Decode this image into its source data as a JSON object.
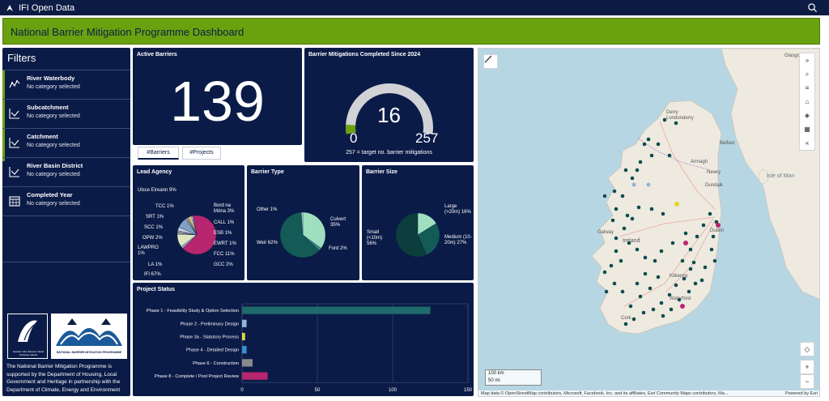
{
  "app": {
    "title": "IFI Open Data"
  },
  "dashboard": {
    "title": "National Barrier Mitigation Programme Dashboard"
  },
  "filters": {
    "title": "Filters",
    "items": [
      {
        "name": "River Waterbody",
        "value": "No category selected",
        "icon": "river-icon"
      },
      {
        "name": "Subcatchment",
        "value": "No category selected",
        "icon": "chart-line-icon"
      },
      {
        "name": "Catchment",
        "value": "No category selected",
        "icon": "chart-line-icon"
      },
      {
        "name": "River Basin District",
        "value": "No category selected",
        "icon": "chart-line-icon"
      },
      {
        "name": "Completed Year",
        "value": "No category selected",
        "icon": "calendar-icon"
      }
    ],
    "logo_ifi_caption": "Iascach Intíre Éireann Inland Fisheries Ireland",
    "logo_nbmp_caption": "NATIONAL BARRIER MITIGATION PROGRAMME",
    "about": "The National Barrier Mitigation Programme is supported by the Department of Housing, Local Government and Heritage in partnership with the Department of Climate, Energy and Environment"
  },
  "active_barriers": {
    "title": "Active Barriers",
    "value": "139"
  },
  "tabs": [
    {
      "label": "#Barriers",
      "selected": true
    },
    {
      "label": "#Projects",
      "selected": false
    }
  ],
  "mitigations": {
    "title": "Barrier Mitigations Completed Since 2024",
    "value": "16",
    "min": "0",
    "max": "257",
    "note": "257 = target no. barrier mitigations",
    "track_color": "#d0d2d6",
    "fill_color": "#6aa10f"
  },
  "lead_agency": {
    "title": "Lead Agency",
    "chart_data": {
      "type": "pie",
      "slices": [
        {
          "label": "IFI 67%",
          "value": 67,
          "color": "#b8256f"
        },
        {
          "label": "GCC 2%",
          "value": 2,
          "color": "#9ab0c8"
        },
        {
          "label": "FCC 11%",
          "value": 11,
          "color": "#dfe7bf"
        },
        {
          "label": "EWRT 1%",
          "value": 1,
          "color": "#8fb0a9"
        },
        {
          "label": "ESB 1%",
          "value": 1,
          "color": "#d9c7a7"
        },
        {
          "label": "CALL 1%",
          "value": 1,
          "color": "#b5b5b5"
        },
        {
          "label": "Bord na Móna 3%",
          "value": 3,
          "color": "#c8d3e0"
        },
        {
          "label": "Ulsce Eireann 9%",
          "value": 9,
          "color": "#7fa0c0"
        },
        {
          "label": "TCC 1%",
          "value": 1,
          "color": "#a9b6c4"
        },
        {
          "label": "SRT 1%",
          "value": 1,
          "color": "#caa7c4"
        },
        {
          "label": "SCC 1%",
          "value": 1,
          "color": "#d2d78e"
        },
        {
          "label": "OPW 2%",
          "value": 2,
          "color": "#e6d879"
        },
        {
          "label": "LAWPRO 1%",
          "value": 1,
          "color": "#e8e8e8"
        },
        {
          "label": "LA 1%",
          "value": 1,
          "color": "#9e7cc4"
        }
      ]
    }
  },
  "barrier_type": {
    "title": "Barrier Type",
    "chart_data": {
      "type": "pie",
      "slices": [
        {
          "label": "Culvert 35%",
          "value": 35,
          "color": "#9fdfc0"
        },
        {
          "label": "Ford 2%",
          "value": 2,
          "color": "#3e8b83"
        },
        {
          "label": "Weir 62%",
          "value": 62,
          "color": "#145a56"
        },
        {
          "label": "Other 1%",
          "value": 1,
          "color": "#b7e3d3"
        }
      ]
    }
  },
  "barrier_size": {
    "title": "Barrier Size",
    "chart_data": {
      "type": "pie",
      "slices": [
        {
          "label": "Large (>20m) 16%",
          "value": 16,
          "color": "#9fdfc0"
        },
        {
          "label": "Medium (10-20m) 27%",
          "value": 27,
          "color": "#145a56"
        },
        {
          "label": "Small (<10m) 56%",
          "value": 56,
          "color": "#0b3e3c"
        }
      ]
    }
  },
  "project_status": {
    "title": "Project Status",
    "chart_data": {
      "type": "bar",
      "orientation": "horizontal",
      "categories": [
        "Phase 1 - Feasibility Study & Option Selection",
        "Phase 2 - Preliminary Design",
        "Phase 3a - Statutory Process",
        "Phase 4 - Detailed Design",
        "Phase 6 - Construction",
        "Phase 8 - Complete / Post Project Review"
      ],
      "values": [
        125,
        3,
        2,
        3,
        7,
        17
      ],
      "colors": [
        "#1f6a6b",
        "#8fb6d8",
        "#e7d63f",
        "#3a8fd0",
        "#8a8a8a",
        "#b8256f"
      ],
      "xlim": [
        0,
        150
      ],
      "xticks": [
        "0",
        "50",
        "100",
        "150"
      ]
    }
  },
  "map": {
    "labels": [
      "Glasgow",
      "Derry Londonderry",
      "Belfast",
      "Armagh",
      "Newry",
      "Isle of Man",
      "Dundalk",
      "Galway",
      "Ireland",
      "Dublin",
      "Kilkenny",
      "Waterford",
      "Cork"
    ],
    "scale": [
      "100 km",
      "50 mi"
    ],
    "attribution": "Map data © OpenStreetMap contributors, Microsoft, Facebook, Inc. and its affiliates, Esri Community Maps contributors, Ma...",
    "powered": "Powered by Esri",
    "tools": [
      "expand-icon",
      "search-icon",
      "list-icon",
      "home-icon",
      "layers-icon",
      "basemap-icon",
      "collapse-icon"
    ]
  }
}
